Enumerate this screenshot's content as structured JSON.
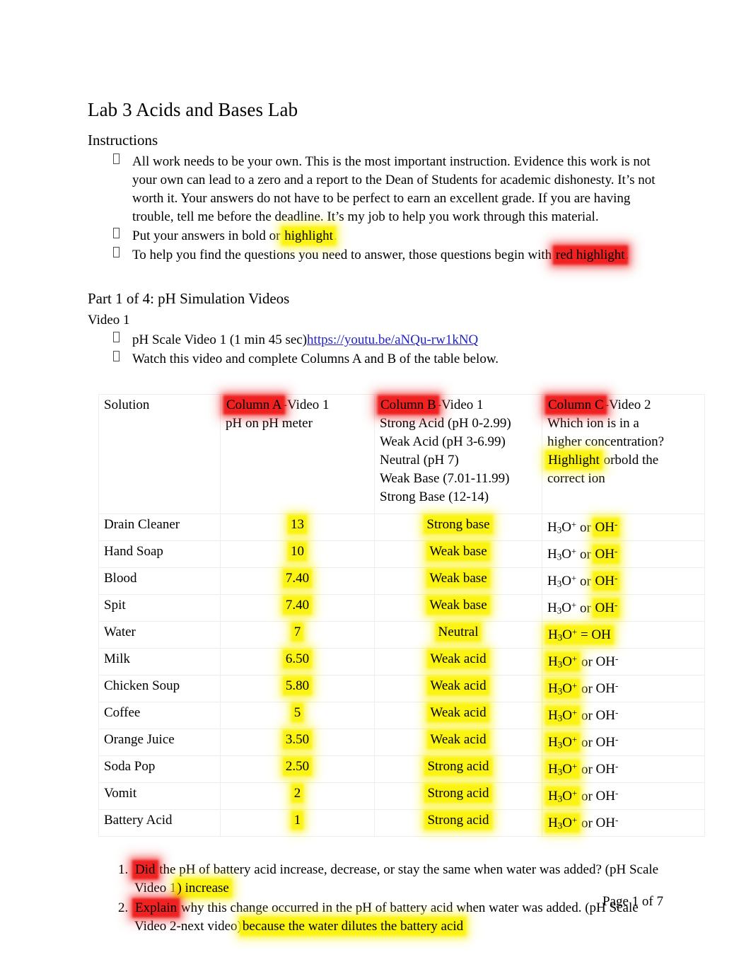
{
  "document": {
    "title": "Lab 3 Acids and Bases Lab",
    "footer": "Page 1 of 7"
  },
  "instructions": {
    "heading": "Instructions",
    "items": [
      {
        "text": "All work needs to be your own. This is the most important instruction. Evidence this work is not your own can lead to a zero and a report to the Dean of Students for academic dishonesty. It’s not worth it. Your answers do not have to be perfect to earn an excellent grade. If you are having trouble, tell me before the deadline. It’s my job to help you work through this material."
      },
      {
        "before": "Put your answers in bold or ",
        "highlight_yellow": "highlight",
        "after": "."
      },
      {
        "before": "To help you find the questions you need to answer, those questions begin with  ",
        "highlight_red": "red highlight",
        "after": "."
      }
    ]
  },
  "part1": {
    "heading": "Part 1 of 4: pH Simulation Videos",
    "video_heading": "Video 1",
    "items": [
      {
        "text": "pH Scale Video 1 (1 min 45 sec)",
        "link": "https://youtu.be/aNQu-rw1kNQ"
      },
      {
        "text": "Watch this video and complete Columns A and B of the table below."
      }
    ]
  },
  "table": {
    "headers": {
      "solution": "Solution",
      "col_a": {
        "badge": "Column A",
        "rest": "-Video 1",
        "lines": [
          "pH on pH meter"
        ]
      },
      "col_b": {
        "badge": "Column B",
        "rest": "-Video 1",
        "lines": [
          "Strong Acid (pH 0-2.99)",
          "Weak Acid (pH 3-6.99)",
          "Neutral (pH 7)",
          "Weak Base (7.01-11.99)",
          "Strong Base (12-14)"
        ]
      },
      "col_c": {
        "badge": "Column C",
        "rest": "-Video 2",
        "lines": [
          "Which ion is in a",
          "higher concentration?"
        ],
        "highlight_word": "Highlight",
        "after_highlight": " orbold the",
        "last_line": "correct ion"
      }
    },
    "rows": [
      {
        "solution": "Drain Cleaner",
        "ph": "13",
        "classification": "Strong base",
        "ion_highlight": "OH"
      },
      {
        "solution": "Hand Soap",
        "ph": "10",
        "classification": "Weak base",
        "ion_highlight": "OH"
      },
      {
        "solution": "Blood",
        "ph": "7.40",
        "classification": "Weak base",
        "ion_highlight": "OH"
      },
      {
        "solution": "Spit",
        "ph": "7.40",
        "classification": "Weak base",
        "ion_highlight": "OH"
      },
      {
        "solution": "Water",
        "ph": "7",
        "classification": "Neutral",
        "ion_highlight": "BOTH",
        "connector": "="
      },
      {
        "solution": "Milk",
        "ph": "6.50",
        "classification": "Weak acid",
        "ion_highlight": "H3O"
      },
      {
        "solution": "Chicken Soup",
        "ph": "5.80",
        "classification": "Weak acid",
        "ion_highlight": "H3O"
      },
      {
        "solution": "Coffee",
        "ph": "5",
        "classification": "Weak acid",
        "ion_highlight": "H3O"
      },
      {
        "solution": "Orange Juice",
        "ph": "3.50",
        "classification": "Weak acid",
        "ion_highlight": "H3O"
      },
      {
        "solution": "Soda Pop",
        "ph": "2.50",
        "classification": "Strong acid",
        "ion_highlight": "H3O"
      },
      {
        "solution": "Vomit",
        "ph": "2",
        "classification": "Strong acid",
        "ion_highlight": "H3O"
      },
      {
        "solution": "Battery Acid",
        "ph": "1",
        "classification": "Strong acid",
        "ion_highlight": "H3O"
      }
    ],
    "ion_text": {
      "hydronium_h": "H",
      "hydronium_sub": "3",
      "hydronium_o": "O",
      "hydronium_sup": "+",
      "connector_or": " or ",
      "connector_eq": " = ",
      "hydroxide": "OH",
      "hydroxide_sup": "-"
    }
  },
  "questions": [
    {
      "highlight_red": "Did",
      "body": " the pH of battery acid increase, decrease, or stay the same when water was added? (pH Scale Video 1",
      "tail": ")",
      "answer": "increase"
    },
    {
      "highlight_red": "Explain",
      "body": " why this change occurred in the pH of battery acid when water was added.   (pH Scale Video 2-next video)",
      "tail": "",
      "answer": "because the water dilutes the battery acid"
    }
  ]
}
